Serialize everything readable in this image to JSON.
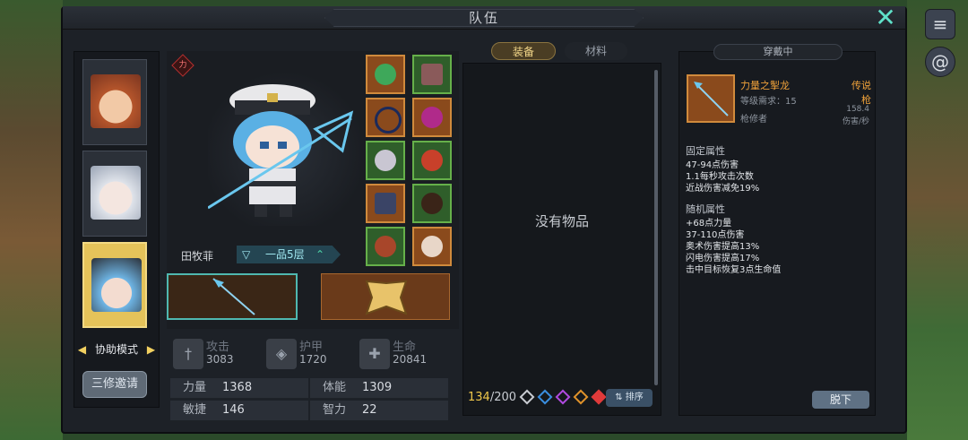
{
  "window": {
    "title": "队伍",
    "close_icon": "close-icon"
  },
  "side_buttons": [
    {
      "icon": "menu-icon",
      "glyph": "≡"
    },
    {
      "icon": "swirl-icon",
      "glyph": "๑"
    }
  ],
  "party": {
    "portraits": [
      {
        "name": "brown-hair-hero",
        "face_color": "#c46a3c"
      },
      {
        "name": "silver-hair-girl",
        "face_color": "#d7dde6"
      },
      {
        "name": "captain-hat-girl",
        "face_color": "#6fb6e6",
        "selected": true
      }
    ],
    "mode_label": "协助模式",
    "invite_label": "三修邀请"
  },
  "character": {
    "strength_badge": "力",
    "name": "田牧菲",
    "rank": "一品5层",
    "equipment_slots": [
      {
        "icon": "helmet-icon",
        "color": "orange"
      },
      {
        "icon": "book-icon",
        "color": "green"
      },
      {
        "icon": "necklace-icon",
        "color": "orange"
      },
      {
        "icon": "gem-icon",
        "color": "orange"
      },
      {
        "icon": "armor-icon",
        "color": "green"
      },
      {
        "icon": "bow-icon",
        "color": "green"
      },
      {
        "icon": "belt-icon",
        "color": "orange"
      },
      {
        "icon": "boots-icon",
        "color": "green"
      },
      {
        "icon": "ring-icon",
        "color": "green"
      },
      {
        "icon": "trinket-icon",
        "color": "orange"
      }
    ]
  },
  "stats": {
    "attack": {
      "label": "攻击",
      "value": "3083"
    },
    "armor": {
      "label": "护甲",
      "value": "1720"
    },
    "health": {
      "label": "生命",
      "value": "20841"
    },
    "attributes": [
      {
        "label": "力量",
        "value": "1368"
      },
      {
        "label": "体能",
        "value": "1309"
      },
      {
        "label": "敏捷",
        "value": "146"
      },
      {
        "label": "智力",
        "value": "22"
      }
    ]
  },
  "inventory": {
    "tabs": [
      "装备",
      "材料"
    ],
    "active_tab": "装备",
    "empty_text": "没有物品",
    "count_current": "134",
    "count_total": "/200",
    "filter_colors": [
      "#c9ccd2",
      "#3a8ee0",
      "#b04ae0",
      "#e0922a",
      "#e03a3a"
    ],
    "sort_label": "排序"
  },
  "detail": {
    "header": "穿戴中",
    "item_name": "力量之掣龙",
    "quality": "传说枪",
    "level_req": "等级需求：15",
    "class": "枪修者",
    "dps_value": "158.4",
    "dps_unit": "伤害/秒",
    "fixed_title": "固定属性",
    "fixed_attrs": [
      "47-94点伤害",
      "1.1每秒攻击次数",
      "近战伤害减免19%"
    ],
    "random_title": "随机属性",
    "random_attrs": [
      "+68点力量",
      "37-110点伤害",
      "奥术伤害提高13%",
      "闪电伤害提高17%",
      "击中目标恢复3点生命值"
    ],
    "unequip_label": "脱下"
  }
}
